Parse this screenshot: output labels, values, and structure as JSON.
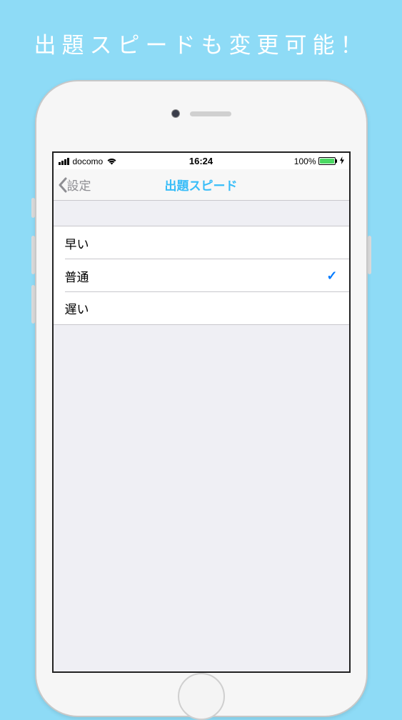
{
  "promo": {
    "tagline": "出題スピードも変更可能！"
  },
  "statusBar": {
    "carrier": "docomo",
    "time": "16:24",
    "batteryPercent": "100%"
  },
  "navBar": {
    "backLabel": "設定",
    "title": "出題スピード"
  },
  "options": {
    "items": [
      {
        "label": "早い",
        "selected": false
      },
      {
        "label": "普通",
        "selected": true
      },
      {
        "label": "遅い",
        "selected": false
      }
    ]
  }
}
